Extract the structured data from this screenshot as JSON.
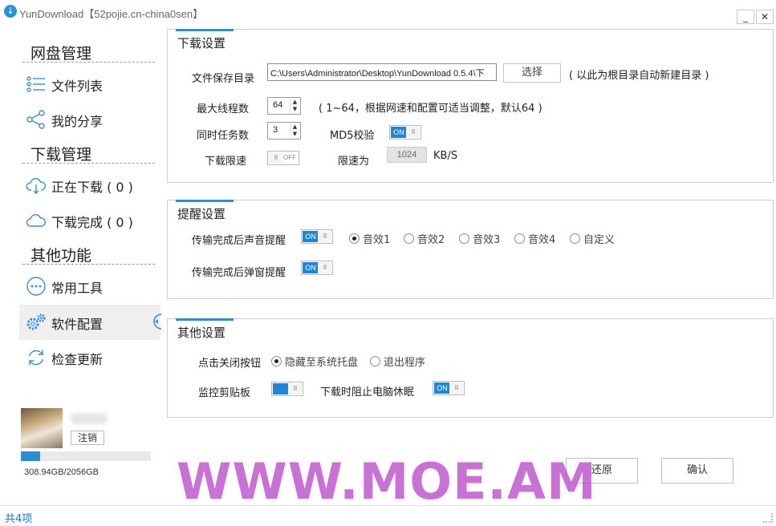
{
  "window": {
    "title": "YunDownload【52pojie.cn-china0sen】",
    "minimize": "_",
    "close": "✕"
  },
  "sidebar": {
    "sections": [
      {
        "title": "网盘管理"
      },
      {
        "title": "下载管理"
      },
      {
        "title": "其他功能"
      }
    ],
    "items": [
      {
        "label": "文件列表",
        "icon": "list-icon"
      },
      {
        "label": "我的分享",
        "icon": "share-icon"
      },
      {
        "label": "正在下载 ( 0 )",
        "icon": "cloud-download-icon"
      },
      {
        "label": "下载完成 ( 0 )",
        "icon": "cloud-done-icon"
      },
      {
        "label": "常用工具",
        "icon": "ellipsis-icon"
      },
      {
        "label": "软件配置",
        "icon": "gears-icon"
      },
      {
        "label": "检查更新",
        "icon": "refresh-icon"
      }
    ],
    "active_item": "软件配置",
    "user": {
      "logout_label": "注销",
      "quota_text": "308.94GB/2056GB",
      "quota_fraction": 0.15
    }
  },
  "download_settings": {
    "title": "下载设置",
    "save_dir_label": "文件保存目录",
    "save_dir_value": "C:\\Users\\Administrator\\Desktop\\YunDownload 0.5.4\\下",
    "choose_label": "选择",
    "save_dir_hint": "( 以此为根目录自动新建目录 )",
    "max_threads_label": "最大线程数",
    "max_threads_value": "64",
    "max_threads_hint": "( 1~64，根据网速和配置可适当调整，默认64 )",
    "concurrent_label": "同时任务数",
    "concurrent_value": "3",
    "md5_label": "MD5校验",
    "speed_limit_label": "下载限速",
    "limit_to_label": "限速为",
    "limit_value": "1024",
    "limit_unit": "KB/S"
  },
  "reminder_settings": {
    "title": "提醒设置",
    "sound_label": "传输完成后声音提醒",
    "popup_label": "传输完成后弹窗提醒",
    "sounds": [
      "音效1",
      "音效2",
      "音效3",
      "音效4",
      "自定义"
    ],
    "selected_sound": "音效1"
  },
  "other_settings": {
    "title": "其他设置",
    "close_btn_label": "点击关闭按钮",
    "close_options": [
      "隐藏至系统托盘",
      "退出程序"
    ],
    "selected_close_option": "隐藏至系统托盘",
    "clipboard_label": "监控剪贴板",
    "prevent_sleep_label": "下载时阻止电脑休眠"
  },
  "toggles": {
    "on_text": "ON",
    "off_text": "OFF",
    "knob_text": "III"
  },
  "actions": {
    "restore_label": "还原",
    "confirm_label": "确认"
  },
  "watermark": "WWW.MOE.AM",
  "status": {
    "text": "共4项"
  },
  "colors": {
    "accent": "#2b8fd8",
    "toggle_on": "#1e86d2",
    "status_text": "#1a73c8",
    "watermark": "#c05ad0"
  }
}
